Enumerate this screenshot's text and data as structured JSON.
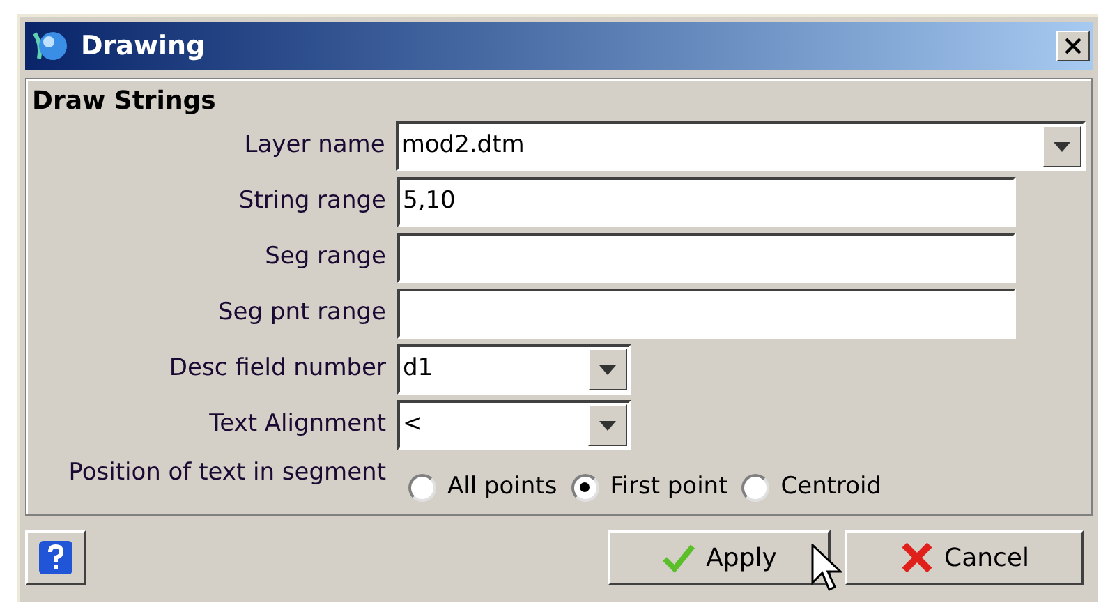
{
  "window": {
    "title": "Drawing"
  },
  "section_title": "Draw Strings",
  "fields": [
    {
      "label": "Layer name",
      "kind": "combo",
      "value": "mod2.dtm"
    },
    {
      "label": "String range",
      "kind": "text",
      "value": "5,10"
    },
    {
      "label": "Seg range",
      "kind": "text"
    },
    {
      "label": "Seg pnt range",
      "kind": "text"
    },
    {
      "label": "Desc field number",
      "kind": "combo",
      "value": "d1"
    },
    {
      "label": "Text Alignment",
      "kind": "combo",
      "value": "<"
    }
  ],
  "position": {
    "label": "Position of text in segment",
    "options": [
      {
        "label": "All points",
        "selected": false
      },
      {
        "label": "First point",
        "selected": true
      },
      {
        "label": "Centroid",
        "selected": false
      }
    ]
  },
  "buttons": [
    {
      "label": "Apply",
      "kind": "apply"
    },
    {
      "label": "Cancel",
      "kind": "cancel"
    }
  ]
}
